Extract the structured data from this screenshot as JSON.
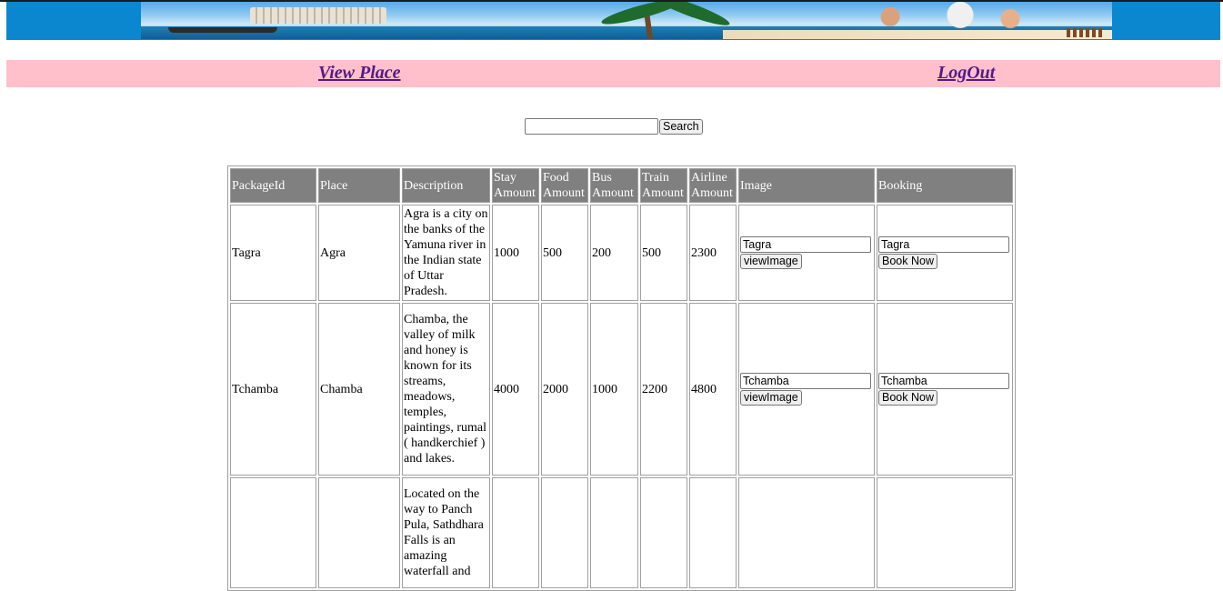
{
  "nav": {
    "view_place": "View Place",
    "logout": "LogOut"
  },
  "search": {
    "value": "",
    "button_label": "Search"
  },
  "table": {
    "headers": {
      "package_id": "PackageId",
      "place": "Place",
      "description": "Description",
      "stay": "Stay Amount",
      "food": "Food Amount",
      "bus": "Bus Amount",
      "train": "Train Amount",
      "airline": "Airline Amount",
      "image": "Image",
      "booking": "Booking"
    },
    "rows": [
      {
        "package_id": "Tagra",
        "place": "Agra",
        "description": "Agra is a city on the banks of the Yamuna river in the Indian state of Uttar Pradesh.",
        "stay": "1000",
        "food": "500",
        "bus": "200",
        "train": "500",
        "airline": "2300",
        "image_value": "Tagra",
        "image_button": "viewImage",
        "booking_value": "Tagra",
        "booking_button": "Book Now"
      },
      {
        "package_id": "Tchamba",
        "place": "Chamba",
        "description": "Chamba, the valley of milk and honey is known for its streams, meadows, temples, paintings, rumal ( handkerchief ) and lakes.",
        "stay": "4000",
        "food": "2000",
        "bus": "1000",
        "train": "2200",
        "airline": "4800",
        "image_value": "Tchamba",
        "image_button": "viewImage",
        "booking_value": "Tchamba",
        "booking_button": "Book Now"
      },
      {
        "package_id": "",
        "place": "",
        "description": "Located on the way to Panch Pula, Sathdhara Falls is an amazing waterfall and",
        "stay": "",
        "food": "",
        "bus": "",
        "train": "",
        "airline": ""
      }
    ]
  }
}
